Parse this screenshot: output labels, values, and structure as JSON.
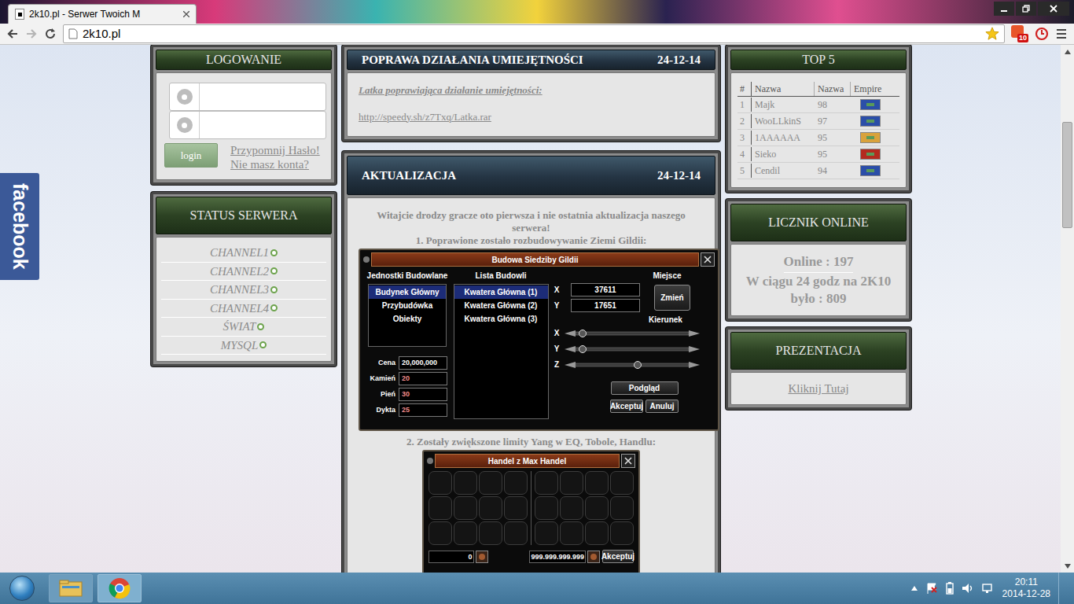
{
  "browser": {
    "tab_title": "2k10.pl - Serwer Twoich M",
    "address": "2k10.pl",
    "extension_badge": "10"
  },
  "facebook_tab": "facebook",
  "login": {
    "title": "LOGOWANIE",
    "button": "login",
    "links": [
      "Przypomnij Hasło!",
      "Nie masz konta?"
    ]
  },
  "server_status": {
    "title": "STATUS SERWERA",
    "items": [
      {
        "name": "CHANNEL1",
        "online": true
      },
      {
        "name": "CHANNEL2",
        "online": true
      },
      {
        "name": "CHANNEL3",
        "online": true
      },
      {
        "name": "CHANNEL4",
        "online": true
      },
      {
        "name": "ŚWIAT",
        "online": true
      },
      {
        "name": "MYSQL",
        "online": true
      }
    ]
  },
  "patch_post": {
    "title": "POPRAWA DZIAŁANIA UMIEJĘTNOŚCI",
    "date": "24-12-14",
    "subtitle": "Latka poprawiająca działanie umiejętności:",
    "link": "http://speedy.sh/z7Txq/Latka.rar"
  },
  "update_post": {
    "title": "AKTUALIZACJA",
    "date": "24-12-14",
    "intro": "Witajcie drodzy gracze oto pierwsza i nie ostatnia aktualizacja naszego serwera!",
    "items": [
      "1. Poprawione zostało rozbudowywanie Ziemi Gildii:",
      "2. Zostały zwiększone limity Yang w EQ, Tobole, Handlu:"
    ]
  },
  "guild_build_window": {
    "title": "Budowa Siedziby Gildii",
    "categories_label": "Jednostki Budowlane",
    "categories": [
      {
        "label": "Budynek Główny",
        "selected": true
      },
      {
        "label": "Przybudówka",
        "selected": false
      },
      {
        "label": "Obiekty",
        "selected": false
      }
    ],
    "buildings_label": "Lista Budowli",
    "buildings": [
      {
        "label": "Kwatera Główna (1)",
        "selected": true
      },
      {
        "label": "Kwatera Główna (2)",
        "selected": false
      },
      {
        "label": "Kwatera Główna (3)",
        "selected": false
      }
    ],
    "place_label": "Miejsce",
    "coords": [
      {
        "label": "X",
        "value": "37611"
      },
      {
        "label": "Y",
        "value": "17651"
      }
    ],
    "change_button": "Zmień",
    "direction_label": "Kierunek",
    "sliders": [
      {
        "axis": "X",
        "level": 0.03
      },
      {
        "axis": "Y",
        "level": 0.03
      },
      {
        "axis": "Z",
        "level": 0.55
      }
    ],
    "costs": [
      {
        "label": "Cena",
        "value": "20,000,000",
        "color": "#ffffff"
      },
      {
        "label": "Kamień",
        "value": "20",
        "color": "#f08a8a"
      },
      {
        "label": "Pień",
        "value": "30",
        "color": "#f08a8a"
      },
      {
        "label": "Dykta",
        "value": "25",
        "color": "#f08a8a"
      }
    ],
    "preview_button": "Podgląd",
    "buttons": [
      "Akceptuj",
      "Anuluj"
    ]
  },
  "trade_window": {
    "title": "Handel z Max Handel",
    "my_yang": "0",
    "their_yang": "999.999.999.999",
    "accept": "Akceptuj"
  },
  "top5": {
    "title": "TOP 5",
    "columns": [
      "#",
      "Nazwa",
      "Nazwa",
      "Empire"
    ],
    "rows": [
      {
        "rank": "1",
        "name": "Majk",
        "level": "98",
        "color": "#2b4ea8"
      },
      {
        "rank": "2",
        "name": "WooLLkinS",
        "level": "97",
        "color": "#2b4ea8"
      },
      {
        "rank": "3",
        "name": "1AAAAAA",
        "level": "95",
        "color": "#d9a23c"
      },
      {
        "rank": "4",
        "name": "Sieko",
        "level": "95",
        "color": "#b32a1f"
      },
      {
        "rank": "5",
        "name": "Cendil",
        "level": "94",
        "color": "#2b4ea8"
      }
    ]
  },
  "online_counter": {
    "title": "LICZNIK ONLINE",
    "online": "Online : 197",
    "daily": "W ciągu 24 godz na 2K10 było : 809"
  },
  "presentation": {
    "title": "PREZENTACJA",
    "link": "Kliknij Tutaj"
  },
  "taskbar": {
    "time": "20:11",
    "date": "2014-12-28"
  }
}
